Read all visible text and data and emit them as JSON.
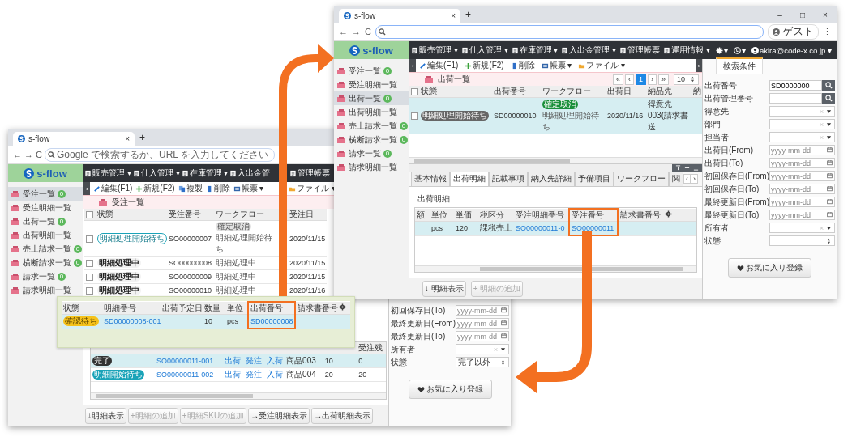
{
  "back_window": {
    "tab_title": "s-flow",
    "tab_close": "×",
    "new_tab": "+",
    "nav": [
      "←",
      "→",
      "C"
    ],
    "address_placeholder": "Google で検索するか、URL を入力してください",
    "logo": "s-flow",
    "menu": [
      "販売管理 ▾",
      "仕入管理 ▾",
      "在庫管理 ▾",
      "入出金管",
      "管理帳票"
    ],
    "toolbar_toggle": "‹",
    "toolbar": [
      {
        "label": "編集(F1)",
        "kind": "edit"
      },
      {
        "label": "新規(F2)",
        "kind": "new"
      },
      {
        "label": "複製",
        "kind": "copy"
      },
      {
        "label": "削除",
        "kind": "delete"
      },
      {
        "label": "帳票 ▾",
        "kind": "report"
      },
      {
        "label": "ファイル ▾",
        "kind": "file"
      }
    ],
    "sidebar": [
      {
        "label": "受注一覧",
        "count": "0",
        "selected": true
      },
      {
        "label": "受注明細一覧",
        "selected": false
      },
      {
        "label": "出荷一覧",
        "count": "0",
        "selected": false
      },
      {
        "label": "出荷明細一覧",
        "selected": false
      },
      {
        "label": "売上請求一覧",
        "count": "0",
        "selected": false
      },
      {
        "label": "横断請求一覧",
        "count": "0",
        "selected": false
      },
      {
        "label": "請求一覧",
        "count": "0",
        "selected": false
      },
      {
        "label": "請求明細一覧",
        "selected": false
      }
    ],
    "list": {
      "title": "受注一覧",
      "all_checked": false,
      "columns": [
        "状態",
        "受注番号",
        "ワークフロー",
        "受注日"
      ],
      "rows": [
        {
          "checked": false,
          "status": {
            "label": "明細処理開始待ち",
            "kind": "waiting"
          },
          "number": "SO00000007",
          "workflow_badge": {
            "label": "確定取消",
            "kind": "cancelled"
          },
          "workflow": "明細処理開始待ち",
          "date": "2020/11/15"
        },
        {
          "checked": false,
          "status": {
            "label": "明細処理中",
            "kind": "processing"
          },
          "number": "SO00000008",
          "workflow": "明細処理中",
          "date": "2020/11/15"
        },
        {
          "checked": false,
          "status": {
            "label": "明細処理中",
            "kind": "processing"
          },
          "number": "SO00000009",
          "workflow": "明細処理中",
          "date": "2020/11/15"
        },
        {
          "checked": false,
          "status": {
            "label": "明細処理中",
            "kind": "processing"
          },
          "number": "SO00000010",
          "workflow": "明細処理中",
          "date": "2020/11/16"
        }
      ]
    },
    "detail": {
      "remaining_header": "受注残",
      "rows": [
        {
          "selected": true,
          "status": {
            "label": "完了",
            "kind": "done"
          },
          "number": "SO00000011-001",
          "links": [
            "出荷",
            "発注",
            "入荷"
          ],
          "item": "商品003",
          "quantity": "10",
          "remaining": "0"
        },
        {
          "selected": false,
          "status": {
            "label": "明細開始待ち",
            "kind": "start"
          },
          "number": "SO00000011-002",
          "links": [
            "出荷",
            "発注",
            "入荷"
          ],
          "item": "商品004",
          "quantity": "20",
          "remaining": "20"
        }
      ]
    },
    "buttons": [
      {
        "icon": "↓",
        "label": "明細表示",
        "disabled": false
      },
      {
        "icon": "+",
        "label": "明細の追加",
        "disabled": true
      },
      {
        "icon": "+",
        "label": "明細SKUの追加",
        "disabled": true
      },
      {
        "icon": "→",
        "label": "受注明細表示",
        "disabled": false
      },
      {
        "icon": "→",
        "label": "出荷明細表示",
        "disabled": false
      }
    ],
    "search_fields": [
      {
        "label": "初回保存日(To)",
        "kind": "date",
        "placeholder": "yyyy-mm-dd"
      },
      {
        "label": "最終更新日(From)",
        "kind": "date",
        "placeholder": "yyyy-mm-dd"
      },
      {
        "label": "最終更新日(To)",
        "kind": "date",
        "placeholder": "yyyy-mm-dd"
      },
      {
        "label": "所有者",
        "kind": "select"
      },
      {
        "label": "状態",
        "kind": "spin",
        "value": "完了以外"
      }
    ],
    "favorite_button": "お気に入り登録"
  },
  "popup": {
    "columns": [
      {
        "label": "状態",
        "highlighted": false
      },
      {
        "label": "明細番号",
        "highlighted": false
      },
      {
        "label": "出荷予定日",
        "highlighted": false
      },
      {
        "label": "数量",
        "highlighted": false
      },
      {
        "label": "単位",
        "highlighted": false
      },
      {
        "label": "出荷番号",
        "highlighted": true
      },
      {
        "label": "請求書番号",
        "highlighted": false
      }
    ],
    "rows": [
      {
        "selected": true,
        "status": {
          "label": "確認待ち",
          "kind": "confirm"
        },
        "line_number": "SD00000008-001",
        "quantity": "10",
        "unit": "pcs",
        "shipment_number": "SD00000008"
      }
    ]
  },
  "front_window": {
    "tab_title": "s-flow",
    "tab_close": "×",
    "new_tab": "+",
    "window_controls": [
      "–",
      "□",
      "×"
    ],
    "nav": [
      "←",
      "→",
      "C"
    ],
    "profile": "ゲスト",
    "more": "⋮",
    "logo": "s-flow",
    "menu": [
      "販売管理 ▾",
      "仕入管理 ▾",
      "在庫管理 ▾",
      "入出金管理 ▾",
      "管理帳票",
      "運用情報 ▾"
    ],
    "settings_caret": "▾",
    "language_caret": "▾",
    "user": "akira@code-x.co.jp ▾",
    "toolbar_toggle": "‹",
    "panel_toggle": "›",
    "toolbar": [
      {
        "label": "編集(F1)",
        "kind": "edit"
      },
      {
        "label": "新規(F2)",
        "kind": "new"
      },
      {
        "label": "削除",
        "kind": "delete"
      },
      {
        "label": "帳票 ▾",
        "kind": "report"
      },
      {
        "label": "ファイル ▾",
        "kind": "file"
      }
    ],
    "sidebar": [
      {
        "label": "受注一覧",
        "count": "0",
        "selected": false
      },
      {
        "label": "受注明細一覧",
        "selected": false
      },
      {
        "label": "出荷一覧",
        "count": "0",
        "selected": true
      },
      {
        "label": "出荷明細一覧",
        "selected": false
      },
      {
        "label": "売上請求一覧",
        "count": "0",
        "selected": false
      },
      {
        "label": "横断請求一覧",
        "count": "0",
        "selected": false
      },
      {
        "label": "請求一覧",
        "count": "0",
        "selected": false
      },
      {
        "label": "請求明細一覧",
        "selected": false
      }
    ],
    "list": {
      "title": "出荷一覧",
      "pager": [
        {
          "label": "«",
          "selected": false
        },
        {
          "label": "‹",
          "selected": false
        },
        {
          "label": "1",
          "selected": true
        },
        {
          "label": "›",
          "selected": false
        },
        {
          "label": "»",
          "selected": false
        }
      ],
      "page_size": "10",
      "all_checked": false,
      "columns": [
        "状態",
        "出荷番号",
        "ワークフロー",
        "出荷日",
        "納品先",
        "納"
      ],
      "rows": [
        {
          "checked": false,
          "selected": true,
          "status": {
            "label": "明細処理開始待ち",
            "kind": "pending"
          },
          "number": "SD00000010",
          "workflow_badge": {
            "label": "確定取消",
            "kind": "approved"
          },
          "workflow": "明細処理開始待ち",
          "date": "2020/11/16",
          "destination": "得意先003(請求書送"
        }
      ]
    },
    "detail_tabs": [
      {
        "label": "基本情報",
        "selected": false
      },
      {
        "label": "出荷明細",
        "selected": true
      },
      {
        "label": "記載事項",
        "selected": false
      },
      {
        "label": "納入先詳細",
        "selected": false
      },
      {
        "label": "予備項目",
        "selected": false
      },
      {
        "label": "ワークフロー",
        "selected": false
      },
      {
        "label": "関",
        "selected": false
      }
    ],
    "tab_scroll": [
      "‹",
      "›"
    ],
    "section_title": "出荷明細",
    "detail": {
      "columns": [
        {
          "label": "額",
          "highlighted": false
        },
        {
          "label": "単位",
          "highlighted": false
        },
        {
          "label": "単価",
          "highlighted": false
        },
        {
          "label": "税区分",
          "highlighted": false
        },
        {
          "label": "受注明細番号",
          "highlighted": false
        },
        {
          "label": "受注番号",
          "highlighted": true
        },
        {
          "label": "請求書番号",
          "highlighted": false
        }
      ],
      "rows": [
        {
          "selected": true,
          "unit": "pcs",
          "unit_price": "120",
          "tax_class": "課税売上",
          "order_line_number": "SO00000011-0",
          "order_number": "SO00000011"
        }
      ]
    },
    "buttons": [
      {
        "icon": "↓",
        "label": "明細表示",
        "disabled": false
      },
      {
        "icon": "+",
        "label": "明細の追加",
        "disabled": true
      }
    ],
    "search_tab": "検索条件",
    "search_fields": [
      {
        "label": "出荷番号",
        "kind": "search",
        "value": "SD0000000"
      },
      {
        "label": "出荷管理番号",
        "kind": "search"
      },
      {
        "label": "得意先",
        "kind": "select"
      },
      {
        "label": "部門",
        "kind": "select"
      },
      {
        "label": "担当者",
        "kind": "select"
      },
      {
        "label": "出荷日(From)",
        "kind": "date",
        "placeholder": "yyyy-mm-dd"
      },
      {
        "label": "出荷日(To)",
        "kind": "date",
        "placeholder": "yyyy-mm-dd"
      },
      {
        "label": "初回保存日(From)",
        "kind": "date",
        "placeholder": "yyyy-mm-dd"
      },
      {
        "label": "初回保存日(To)",
        "kind": "date",
        "placeholder": "yyyy-mm-dd"
      },
      {
        "label": "最終更新日(From)",
        "kind": "date",
        "placeholder": "yyyy-mm-dd"
      },
      {
        "label": "最終更新日(To)",
        "kind": "date",
        "placeholder": "yyyy-mm-dd"
      },
      {
        "label": "所有者",
        "kind": "select"
      },
      {
        "label": "状態",
        "kind": "spin"
      }
    ],
    "favorite_button": "お気に入り登録"
  }
}
